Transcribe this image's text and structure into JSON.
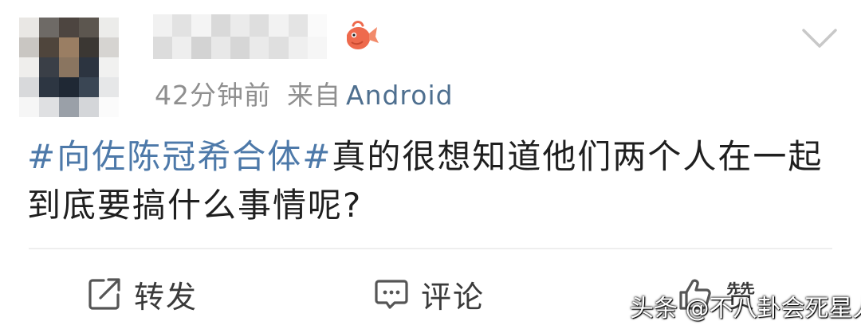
{
  "post": {
    "avatar": {
      "pixels": [
        "#e9e7e4",
        "#6e6a66",
        "#4d4540",
        "#5c564f",
        "#ececea",
        "#c9c6c2",
        "#4f453c",
        "#9a7e63",
        "#3b3733",
        "#d6d4d1",
        "#efeeec",
        "#3a3f47",
        "#8a7560",
        "#2c3440",
        "#f1f1f0",
        "#d8d9db",
        "#2d3642",
        "#1f2834",
        "#3a4654",
        "#e6e7e8",
        "#f6f6f6",
        "#dfe0e2",
        "#9aa0a8",
        "#d4d6d9",
        "#fbfbfb"
      ]
    },
    "username": {
      "pixels": [
        "#f1f1f1",
        "#e2e2e2",
        "#f4f4f4",
        "#d9d9d9",
        "#ebebeb",
        "#dedede",
        "#f2f2f2",
        "#e4e4e4",
        "#fafafa",
        "#dcdcdc",
        "#eeeeee",
        "#d3d3d3",
        "#e8e8e8",
        "#d6d6d6",
        "#eaeaea",
        "#dfdfdf",
        "#efefef",
        "#f6f6f6"
      ]
    },
    "badge_icon": "koi-fish-icon",
    "badge_color": "#ee6a4d",
    "time": "42分钟前",
    "source_prefix": "来自",
    "source_client": "Android",
    "hashtag": "#向佐陈冠希合体#",
    "body": "真的很想知道他们两个人在一起到底要搞什么事情呢?",
    "hashtag_color": "#4d79a9"
  },
  "actions": {
    "repost": {
      "icon": "share-icon",
      "label": "转发"
    },
    "comment": {
      "icon": "comment-icon",
      "label": "评论"
    },
    "like": {
      "icon": "thumbs-up-icon",
      "label": "赞"
    }
  },
  "menu_icon": "chevron-down-icon",
  "watermark": "头条 @不八卦会死星人"
}
